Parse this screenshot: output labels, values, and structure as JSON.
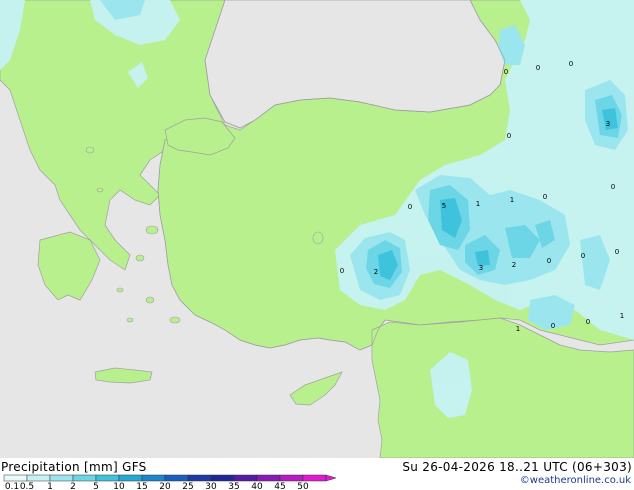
{
  "title": {
    "product": "Precipitation [mm]",
    "model": "GFS",
    "valid_time": "Su 26-04-2026 18..21 UTC (06+303)"
  },
  "credit": "©weatheronline.co.uk",
  "legend": {
    "labels": [
      "0.1",
      "0.5",
      "1",
      "2",
      "5",
      "10",
      "15",
      "20",
      "25",
      "30",
      "35",
      "40",
      "45",
      "50"
    ],
    "colors": [
      "#e8fbfb",
      "#c6f2f4",
      "#9be6ee",
      "#6cd6e6",
      "#3fc2dc",
      "#22a8d6",
      "#1a86cc",
      "#1a5fbf",
      "#1e3aa8",
      "#22249a",
      "#5a1aa8",
      "#8a1ab8",
      "#b81ac6",
      "#e01ad2"
    ]
  },
  "map_colors": {
    "sea": "#e6e6e6",
    "land": "#b8f08e",
    "coast": "#a0a0a0"
  },
  "point_labels": [
    "0",
    "0",
    "0",
    "3",
    "0",
    "0",
    "0",
    "5",
    "1",
    "1",
    "0",
    "0",
    "2",
    "3",
    "2",
    "0",
    "0",
    "0",
    "1",
    "0",
    "0",
    "1"
  ]
}
